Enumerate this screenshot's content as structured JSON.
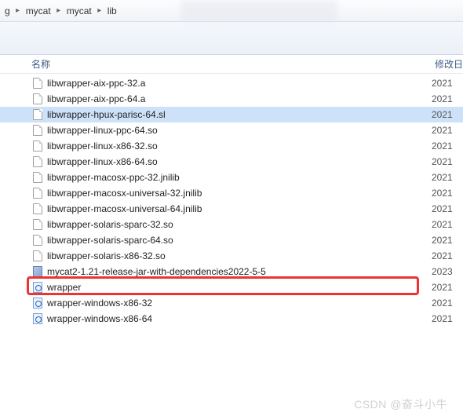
{
  "breadcrumbs": {
    "first": "g",
    "items": [
      "mycat",
      "mycat",
      "lib"
    ]
  },
  "columns": {
    "name": "名称",
    "date": "修改日"
  },
  "files": [
    {
      "name": "libwrapper-aix-ppc-32.a",
      "date": "2021",
      "icon": "file"
    },
    {
      "name": "libwrapper-aix-ppc-64.a",
      "date": "2021",
      "icon": "file"
    },
    {
      "name": "libwrapper-hpux-parisc-64.sl",
      "date": "2021",
      "icon": "file",
      "selected": true
    },
    {
      "name": "libwrapper-linux-ppc-64.so",
      "date": "2021",
      "icon": "file"
    },
    {
      "name": "libwrapper-linux-x86-32.so",
      "date": "2021",
      "icon": "file"
    },
    {
      "name": "libwrapper-linux-x86-64.so",
      "date": "2021",
      "icon": "file"
    },
    {
      "name": "libwrapper-macosx-ppc-32.jnilib",
      "date": "2021",
      "icon": "file"
    },
    {
      "name": "libwrapper-macosx-universal-32.jnilib",
      "date": "2021",
      "icon": "file"
    },
    {
      "name": "libwrapper-macosx-universal-64.jnilib",
      "date": "2021",
      "icon": "file"
    },
    {
      "name": "libwrapper-solaris-sparc-32.so",
      "date": "2021",
      "icon": "file"
    },
    {
      "name": "libwrapper-solaris-sparc-64.so",
      "date": "2021",
      "icon": "file"
    },
    {
      "name": "libwrapper-solaris-x86-32.so",
      "date": "2021",
      "icon": "file"
    },
    {
      "name": "mycat2-1.21-release-jar-with-dependencies2022-5-5",
      "date": "2023",
      "icon": "jar"
    },
    {
      "name": "wrapper",
      "date": "2021",
      "icon": "html"
    },
    {
      "name": "wrapper-windows-x86-32",
      "date": "2021",
      "icon": "html"
    },
    {
      "name": "wrapper-windows-x86-64",
      "date": "2021",
      "icon": "html"
    }
  ],
  "watermark": "CSDN @奋斗小牛"
}
